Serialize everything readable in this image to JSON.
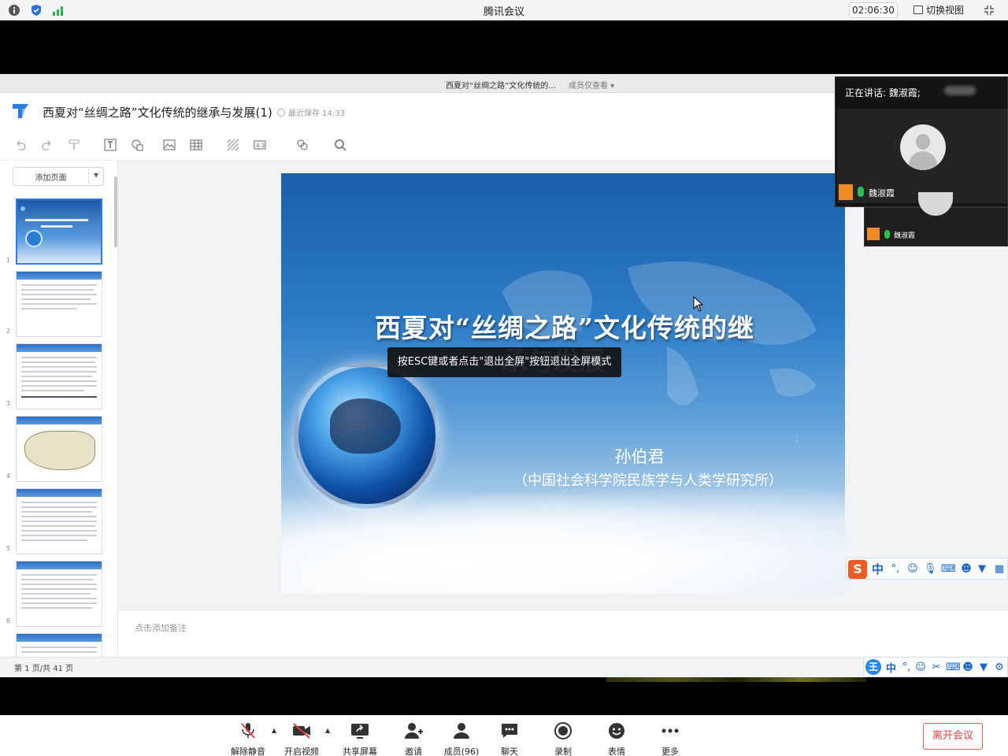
{
  "titlebar": {
    "app_title": "腾讯会议",
    "meeting_time": "02:06:30",
    "switch_view_label": "切换视图"
  },
  "document": {
    "tab_title": "西夏对“丝绸之路”文化传统的...",
    "tab_role": "成员仅查看 ▾",
    "title": "西夏对“丝绸之路”文化传统的继承与发展(1)",
    "saved_status": "最近保存 14:33",
    "add_page_label": "添加页面",
    "notes_placeholder": "点击添加备注",
    "page_counter": "第 1 页/共 41 页",
    "thumbnail_numbers": [
      "1",
      "2",
      "3",
      "4",
      "5",
      "6"
    ]
  },
  "slide": {
    "title_line1": "西夏对“丝绸之路”文化传统的继",
    "title_line2": "承与发展",
    "author": "孙伯君",
    "affiliation": "（中国社会科学院民族学与人类学研究所）"
  },
  "toast": {
    "message": "按ESC键或者点击\"退出全屏\"按钮退出全屏模式"
  },
  "ime": {
    "logo": "S",
    "lang": "中",
    "logo2": "王",
    "lang2": "中"
  },
  "speaker_panel": {
    "label": "正在讲话: 魏淑霞;",
    "participant_name": "魏淑霞",
    "second_tile_name": "魏淑霞"
  },
  "controls": {
    "mute": "解除静音",
    "video": "开启视频",
    "share": "共享屏幕",
    "invite": "邀请",
    "members": "成员(96)",
    "chat": "聊天",
    "record": "录制",
    "reaction": "表情",
    "more": "更多",
    "leave": "离开会议"
  },
  "colors": {
    "leave_red": "#e03e3e",
    "accent_blue": "#2f7ee8",
    "mic_green": "#27c24c",
    "ime_orange": "#f25a22"
  }
}
